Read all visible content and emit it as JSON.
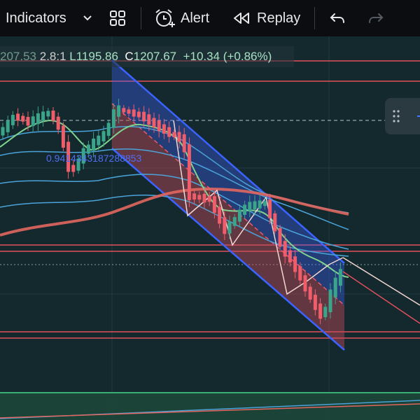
{
  "toolbar": {
    "indicators_label": "Indicators",
    "alert_label": "Alert",
    "replay_label": "Replay"
  },
  "ohlc": {
    "ghost": "207.53",
    "overlap": "2.8:1",
    "low": "L1195.86",
    "close_prefix": "C",
    "close": "1207.67",
    "change": "+10.34",
    "change_pct": "(+0.86%)"
  },
  "fib_label": "0.9414343187288853",
  "colors": {
    "background": "#14292e",
    "up_candle": "#3aa58a",
    "down_candle": "#ef5d6a",
    "channel_line": "#3b63ff",
    "ma_thick": "#e2665f",
    "ma_green": "#7fd38e",
    "band_blue": "#4aa3d9",
    "horizontal_level": "#e2505c"
  }
}
